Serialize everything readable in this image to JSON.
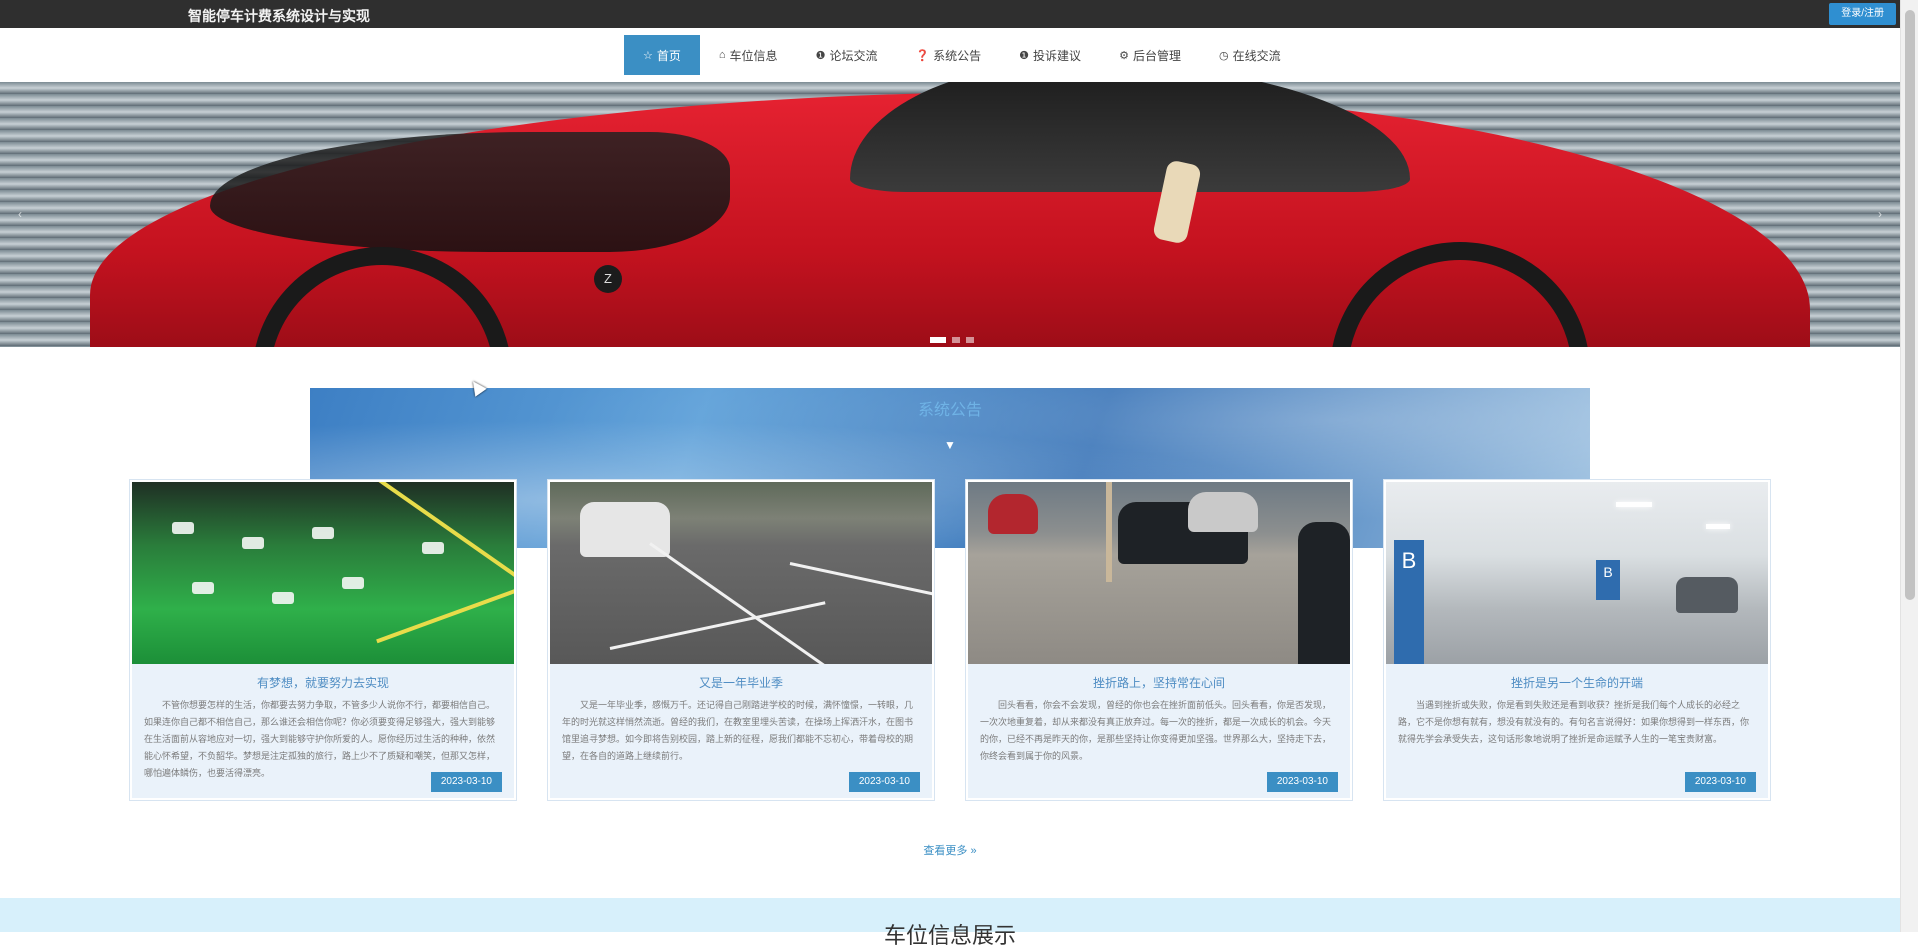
{
  "header": {
    "site_title": "智能停车计费系统设计与实现",
    "login_label": "登录/注册"
  },
  "nav": {
    "items": [
      {
        "label": "首页",
        "icon": "star-icon"
      },
      {
        "label": "车位信息",
        "icon": "home-icon"
      },
      {
        "label": "论坛交流",
        "icon": "info-icon"
      },
      {
        "label": "系统公告",
        "icon": "question-icon"
      },
      {
        "label": "投诉建议",
        "icon": "info-icon"
      },
      {
        "label": "后台管理",
        "icon": "settings-icon"
      },
      {
        "label": "在线交流",
        "icon": "chat-icon"
      }
    ],
    "active_index": 0
  },
  "banner": {
    "slides": 3,
    "active_slide": 0,
    "badge": "Z"
  },
  "section": {
    "title": "系统公告",
    "arrow": "▼",
    "more_link": "查看更多 »"
  },
  "cards": [
    {
      "title": "有梦想，就要努力去实现",
      "body": "不管你想要怎样的生活，你都要去努力争取，不管多少人说你不行，都要相信自己。如果连你自己都不相信自己，那么谁还会相信你呢？你必须要变得足够强大，强大到能够在生活面前从容地应对一切，强大到能够守护你所爱的人。愿你经历过生活的种种，依然能心怀希望，不负韶华。梦想是注定孤独的旅行，路上少不了质疑和嘲笑，但那又怎样，哪怕遍体鳞伤，也要活得漂亮。",
      "date": "2023-03-10"
    },
    {
      "title": "又是一年毕业季",
      "body": "又是一年毕业季，感慨万千。还记得自己刚踏进学校的时候，满怀憧憬，一转眼，几年的时光就这样悄然流逝。曾经的我们，在教室里埋头苦读，在操场上挥洒汗水，在图书馆里追寻梦想。如今即将告别校园，踏上新的征程，愿我们都能不忘初心，带着母校的期望，在各自的道路上继续前行。",
      "date": "2023-03-10"
    },
    {
      "title": "挫折路上，坚持常在心间",
      "body": "回头看看，你会不会发现，曾经的你也会在挫折面前低头。回头看看，你是否发现，一次次地重复着，却从来都没有真正放弃过。每一次的挫折，都是一次成长的机会。今天的你，已经不再是昨天的你，是那些坚持让你变得更加坚强。世界那么大，坚持走下去，你终会看到属于你的风景。",
      "date": "2023-03-10"
    },
    {
      "title": "挫折是另一个生命的开端",
      "body": "当遇到挫折或失败，你是看到失败还是看到收获？挫折是我们每个人成长的必经之路，它不是你想有就有，想没有就没有的。有句名言说得好：如果你想得到一样东西，你就得先学会承受失去，这句话形象地说明了挫折是命运赋予人生的一笔宝贵财富。",
      "date": "2023-03-10"
    }
  ],
  "bottom": {
    "title": "车位信息展示"
  }
}
